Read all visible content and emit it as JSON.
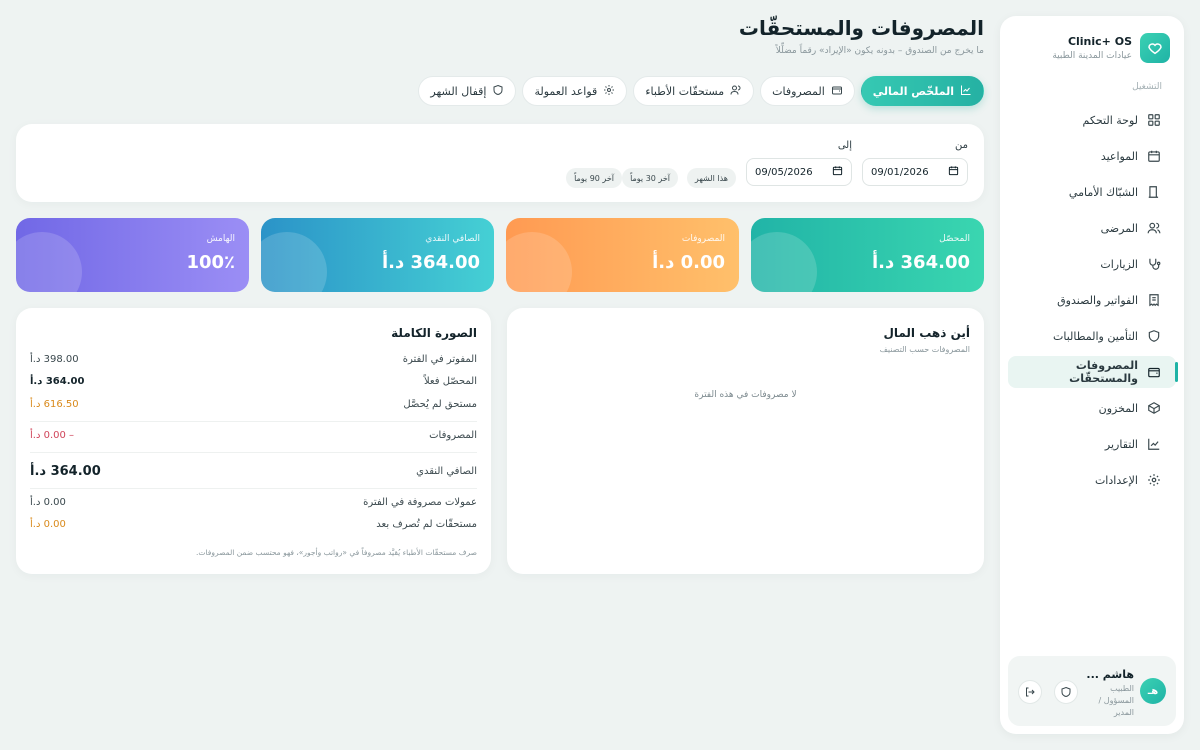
{
  "brand": {
    "title": "Clinic+ OS",
    "subtitle": "عيادات المدينة الطبية"
  },
  "sidebar": {
    "section_label": "التشغيل",
    "items": [
      {
        "label": "لوحة التحكم",
        "icon": "grid-icon",
        "active": false
      },
      {
        "label": "المواعيد",
        "icon": "calendar-icon",
        "active": false
      },
      {
        "label": "الشبّاك الأمامي",
        "icon": "door-icon",
        "active": false
      },
      {
        "label": "المرضى",
        "icon": "users-icon",
        "active": false
      },
      {
        "label": "الزيارات",
        "icon": "stethoscope-icon",
        "active": false
      },
      {
        "label": "الفواتير والصندوق",
        "icon": "receipt-icon",
        "active": false
      },
      {
        "label": "التأمين والمطالبات",
        "icon": "shield-icon",
        "active": false
      },
      {
        "label": "المصروفات والمستحقّات",
        "icon": "wallet-icon",
        "active": true
      },
      {
        "label": "المخزون",
        "icon": "box-icon",
        "active": false
      },
      {
        "label": "التقارير",
        "icon": "chart-icon",
        "active": false
      },
      {
        "label": "الإعدادات",
        "icon": "gear-icon",
        "active": false
      }
    ]
  },
  "user": {
    "initials": "هـ",
    "name": "هاشم ...",
    "role": "الطبيب المسؤول / المدير"
  },
  "header": {
    "title": "المصروفات والمستحقّات",
    "subtitle": "ما يخرج من الصندوق – بدونه يكون «الإيراد» رقماً مضلِّلاً"
  },
  "tabs": [
    {
      "label": "الملخّص المالي",
      "icon": "chart-icon",
      "active": true
    },
    {
      "label": "المصروفات",
      "icon": "wallet-icon",
      "active": false
    },
    {
      "label": "مستحقّات الأطباء",
      "icon": "users-icon",
      "active": false
    },
    {
      "label": "قواعد العمولة",
      "icon": "gear-icon",
      "active": false
    },
    {
      "label": "إقفال الشهر",
      "icon": "shield-icon",
      "active": false
    }
  ],
  "filter": {
    "from_label": "من",
    "to_label": "إلى",
    "from_value": "09/01/2026",
    "to_value": "09/05/2026",
    "presets": [
      "هذا الشهر",
      "آخر 30 يوماً",
      "آخر 90 يوماً"
    ]
  },
  "kpis": [
    {
      "label": "المحصّل",
      "value": "364.00 د.أ"
    },
    {
      "label": "المصروفات",
      "value": "0.00 د.أ"
    },
    {
      "label": "الصافي النقدي",
      "value": "364.00 د.أ"
    },
    {
      "label": "الهامش",
      "value": "100٪"
    }
  ],
  "colors": {
    "kpi_green": [
      "#3ad6b0",
      "#21b4a7"
    ],
    "kpi_orange": [
      "#ffc06b",
      "#ff9a52"
    ],
    "kpi_teal": [
      "#45d0d4",
      "#2b93c8"
    ],
    "kpi_purple": [
      "#9b8ef5",
      "#7168e6"
    ],
    "accent": "#1fb3a6",
    "warning": "#d98a1c",
    "danger": "#d0455a"
  },
  "where_money": {
    "title": "أين ذهب المال",
    "subtitle": "المصروفات حسب التصنيف",
    "empty": "لا مصروفات في هذه الفترة"
  },
  "full_picture": {
    "title": "الصورة الكاملة",
    "rows": [
      {
        "label": "المفوتر في الفترة",
        "value": "398.00 د.أ"
      },
      {
        "label": "المحصّل فعلاً",
        "value": "364.00 د.أ"
      },
      {
        "label": "مستحق لم يُحصَّل",
        "value": "616.50 د.أ"
      },
      {
        "label": "المصروفات",
        "value": "– 0.00 د.أ"
      },
      {
        "label": "الصافي النقدي",
        "value": "364.00 د.أ"
      },
      {
        "label": "عمولات مصروفة في الفترة",
        "value": "0.00 د.أ"
      },
      {
        "label": "مستحقّات لم تُصرف بعد",
        "value": "0.00 د.أ"
      }
    ],
    "note": "صرف مستحقّات الأطباء يُقيَّد مصروفاً في «رواتب وأجور»، فهو محتسب ضمن المصروفات."
  }
}
